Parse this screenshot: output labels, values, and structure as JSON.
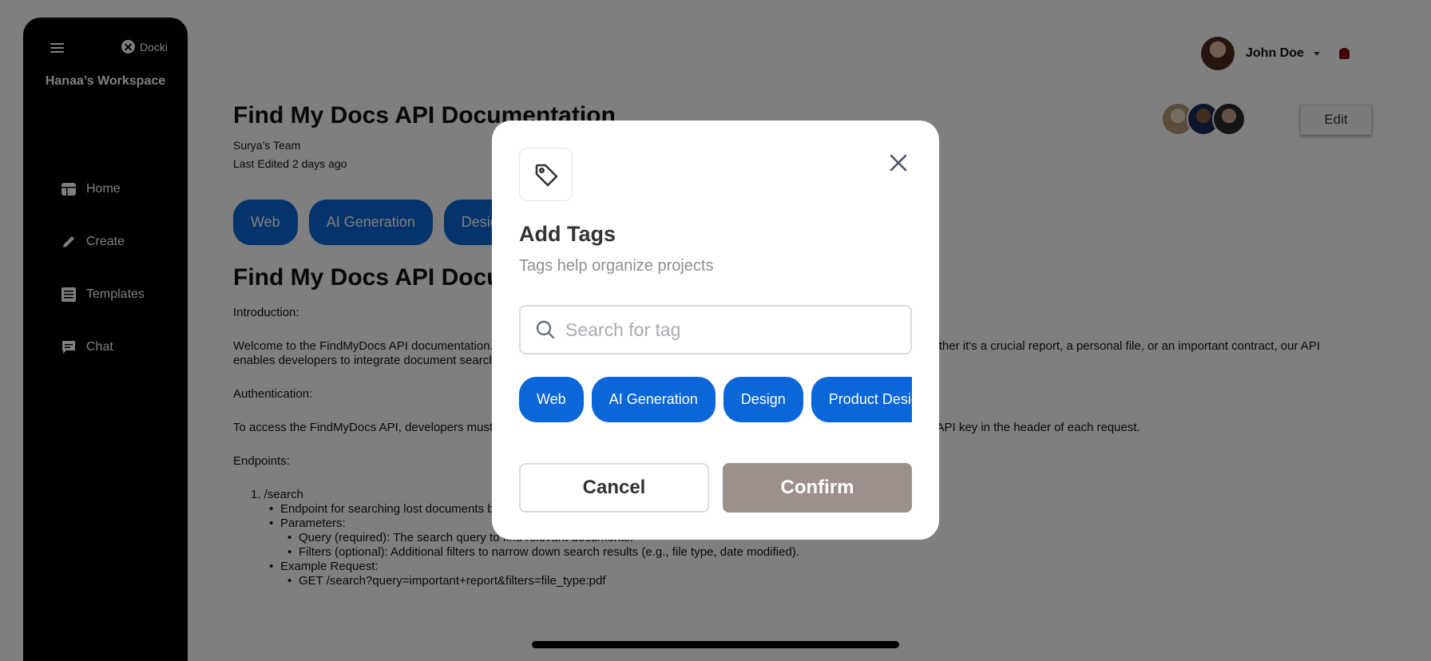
{
  "sidebar": {
    "brand": "Docki",
    "workspace": "Hanaa’s Workspace",
    "items": [
      {
        "label": "Home",
        "icon": "dashboard-icon"
      },
      {
        "label": "Create",
        "icon": "pencil-icon"
      },
      {
        "label": "Templates",
        "icon": "list-icon"
      },
      {
        "label": "Chat",
        "icon": "chat-icon"
      }
    ]
  },
  "header": {
    "user_name": "John Doe",
    "edit_label": "Edit"
  },
  "document": {
    "title": "Find My Docs API Documentation",
    "team": "Surya’s Team",
    "last_edited": "Last Edited 2 days ago",
    "tags": [
      "Web",
      "AI Generation",
      "Design"
    ],
    "heading": "Find My Docs API Documentation",
    "intro_label": "Introduction:",
    "intro_text": "Welcome to the FindMyDocs API documentation. Our API lets you search for and retrieve your important documents effortlessly. Whether it's a crucial report, a personal file, or an important contract, our API enables developers to integrate document search into their applications.",
    "auth_label": "Authentication:",
    "auth_text": "To access the FindMyDocs API, developers must obtain an API key by registering on our developer portal. Authentication is done via API key in the header of each request.",
    "endpoints_label": "Endpoints:",
    "endpoint_path": "1. /search",
    "endpoint_desc": "Endpoint for searching lost documents based on keywords and filters.",
    "params_label": "Parameters:",
    "param_query": "Query (required): The search query to find relevant documents.",
    "param_filters": "Filters (optional): Additional filters to narrow down search results (e.g., file type, date modified).",
    "example_label": "Example Request:",
    "example_text": "GET /search?query=important+report&filters=file_type:pdf"
  },
  "modal": {
    "title": "Add Tags",
    "subtitle": "Tags help organize projects",
    "search_placeholder": "Search for tag",
    "tags": [
      "Web",
      "AI Generation",
      "Design",
      "Product Design"
    ],
    "cancel_label": "Cancel",
    "confirm_label": "Confirm"
  },
  "colors": {
    "tag_blue": "#0a66d9",
    "confirm_bg": "#9d908c",
    "sidebar_bg": "#000000"
  }
}
